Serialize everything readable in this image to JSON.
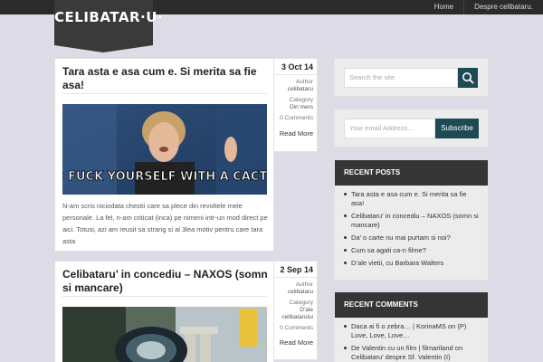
{
  "nav": {
    "home": "Home",
    "about": "Despre celibataru."
  },
  "logo": {
    "text": "CELIBATAR·U·"
  },
  "posts": [
    {
      "title": "Tara asta e asa cum e. Si merita sa fie asa!",
      "image_caption": "GO FUCK YOURSELF WITH A CACTUS",
      "excerpt": "N-am scris niciodata chestii care sa plece din revoltele mele personale. La fel, n-am criticat (inca) pe nimeni intr-un mod direct pe aici. Totusi, azi am reusit sa strang si al 3lea motiv pentru care tara asta",
      "date": "3 Oct 14",
      "author_label": "Author",
      "author": "celibataru",
      "category_label": "Category",
      "category": "Din mers",
      "comments": "0 Comments",
      "read_more": "Read More"
    },
    {
      "title": "Celibataru’ in concediu – NAXOS (somn si mancare)",
      "date": "2 Sep 14",
      "author_label": "Author",
      "author": "celibataru",
      "category_label": "Category",
      "category": "D'ale celibatarului",
      "comments": "0 Comments",
      "read_more": "Read More"
    }
  ],
  "search": {
    "placeholder": "Search the site"
  },
  "subscribe": {
    "placeholder": "Your email Address...",
    "button": "Subscribe"
  },
  "recent_posts": {
    "title": "RECENT POSTS",
    "items": [
      "Tara asta e asa cum e. Si merita sa fie asa!",
      "Celibataru’ in concediu – NAXOS (somn si mancare)",
      "Da’ o carte nu mai purtam si noi?",
      "Cum sa agati ca-n filme?",
      "D’ale vietii, cu Barbara Walters"
    ]
  },
  "recent_comments": {
    "title": "RECENT COMMENTS",
    "items": [
      "Daca ai fi o zebra… | KorinaMS on (P) Love, Love, Love…",
      "De Valentin cu un film | filmariland on Celibataru’ despre Sf. Valentin (I)"
    ]
  },
  "colors": {
    "accent": "#1e4a55",
    "background": "#dddce6",
    "dark": "#353535"
  }
}
